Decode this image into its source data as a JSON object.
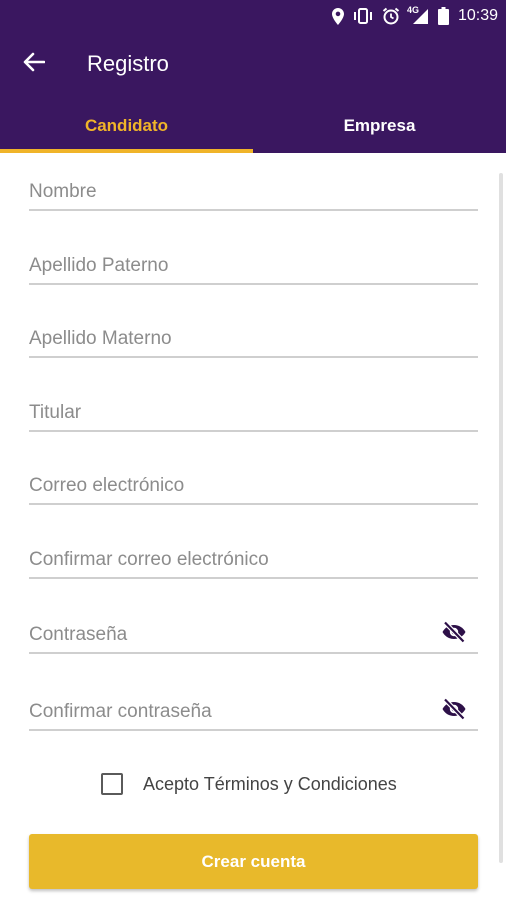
{
  "statusbar": {
    "time": "10:39",
    "network": "4G",
    "icons": [
      "location-icon",
      "vibrate-icon",
      "alarm-icon",
      "signal-icon",
      "battery-icon"
    ]
  },
  "appbar": {
    "title": "Registro",
    "back_icon": "arrow-left-icon"
  },
  "tabs": [
    {
      "label": "Candidato",
      "active": true
    },
    {
      "label": "Empresa",
      "active": false
    }
  ],
  "form": {
    "fields": [
      {
        "placeholder": "Nombre",
        "value": ""
      },
      {
        "placeholder": "Apellido Paterno",
        "value": ""
      },
      {
        "placeholder": "Apellido Materno",
        "value": ""
      },
      {
        "placeholder": "Titular",
        "value": ""
      },
      {
        "placeholder": "Correo electrónico",
        "value": ""
      },
      {
        "placeholder": "Confirmar correo electrónico",
        "value": ""
      },
      {
        "placeholder": "Contraseña",
        "value": "",
        "icon": "eye-off-icon"
      },
      {
        "placeholder": "Confirmar contraseña",
        "value": "",
        "icon": "eye-off-icon"
      }
    ],
    "terms_label": "Acepto Términos y Condiciones",
    "terms_checked": false,
    "submit_label": "Crear cuenta"
  },
  "colors": {
    "primary": "#3a1760",
    "accent": "#f0b429",
    "button": "#e8b92b"
  }
}
